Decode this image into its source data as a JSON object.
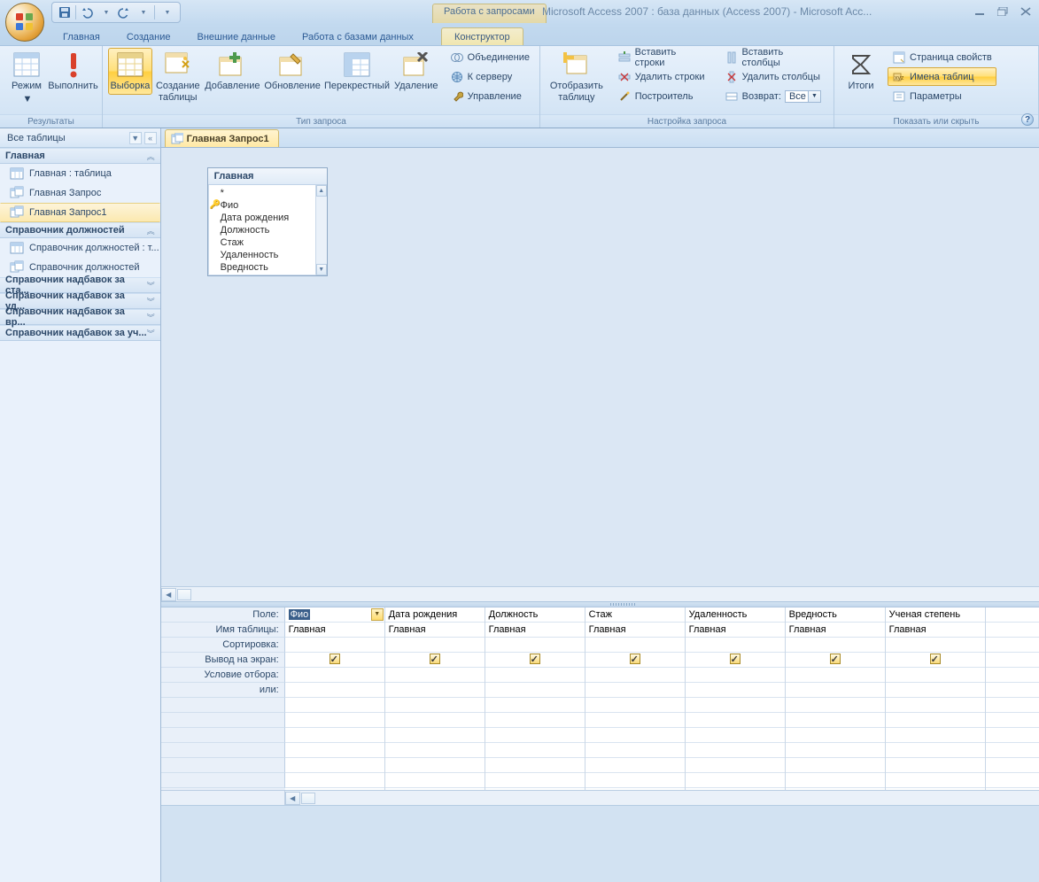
{
  "app_title": "Microsoft Access 2007 : база данных (Access 2007) - Microsoft Acc...",
  "context_tab_group": "Работа с запросами",
  "ribbon_tabs": {
    "home": "Главная",
    "create": "Создание",
    "external": "Внешние данные",
    "dbtools": "Работа с базами данных",
    "designer": "Конструктор"
  },
  "ribbon": {
    "results": {
      "view": "Режим",
      "run": "Выполнить",
      "label": "Результаты"
    },
    "qtype": {
      "select": "Выборка",
      "maketable": "Создание\nтаблицы",
      "append": "Добавление",
      "update": "Обновление",
      "crosstab": "Перекрестный",
      "delete": "Удаление",
      "union": "Объединение",
      "passthrough": "К серверу",
      "datadef": "Управление",
      "label": "Тип запроса"
    },
    "setup": {
      "showtable": "Отобразить\nтаблицу",
      "insrows": "Вставить строки",
      "delrows": "Удалить строки",
      "builder": "Построитель",
      "inscols": "Вставить столбцы",
      "delcols": "Удалить столбцы",
      "return": "Возврат:",
      "return_val": "Все",
      "label": "Настройка запроса"
    },
    "showhide": {
      "totals": "Итоги",
      "propsheet": "Страница свойств",
      "tablenames": "Имена таблиц",
      "params": "Параметры",
      "label": "Показать или скрыть"
    }
  },
  "nav": {
    "header": "Все таблицы",
    "groups": [
      {
        "title": "Главная",
        "expanded": true,
        "items": [
          {
            "kind": "table",
            "label": "Главная : таблица"
          },
          {
            "kind": "query",
            "label": "Главная Запрос"
          },
          {
            "kind": "query",
            "label": "Главная Запрос1",
            "selected": true
          }
        ]
      },
      {
        "title": "Справочник должностей",
        "expanded": true,
        "items": [
          {
            "kind": "table",
            "label": "Справочник должностей : т..."
          },
          {
            "kind": "query",
            "label": "Справочник должностей"
          }
        ]
      },
      {
        "title": "Справочник надбавок за ста...",
        "expanded": false
      },
      {
        "title": "Справочник надбавок за уд...",
        "expanded": false
      },
      {
        "title": "Справочник надбавок за вр...",
        "expanded": false
      },
      {
        "title": "Справочник надбавок за уч...",
        "expanded": false
      }
    ]
  },
  "doc_tab": "Главная Запрос1",
  "table_box": {
    "title": "Главная",
    "fields": [
      "*",
      "Фио",
      "Дата рождения",
      "Должность",
      "Стаж",
      "Удаленность",
      "Вредность"
    ],
    "key_field": "Фио"
  },
  "grid": {
    "row_labels": [
      "Поле:",
      "Имя таблицы:",
      "Сортировка:",
      "Вывод на экран:",
      "Условие отбора:",
      "или:"
    ],
    "columns": [
      {
        "field": "Фио",
        "table": "Главная",
        "show": true
      },
      {
        "field": "Дата рождения",
        "table": "Главная",
        "show": true
      },
      {
        "field": "Должность",
        "table": "Главная",
        "show": true
      },
      {
        "field": "Стаж",
        "table": "Главная",
        "show": true
      },
      {
        "field": "Удаленность",
        "table": "Главная",
        "show": true
      },
      {
        "field": "Вредность",
        "table": "Главная",
        "show": true
      },
      {
        "field": "Ученая степень",
        "table": "Главная",
        "show": true
      }
    ]
  }
}
